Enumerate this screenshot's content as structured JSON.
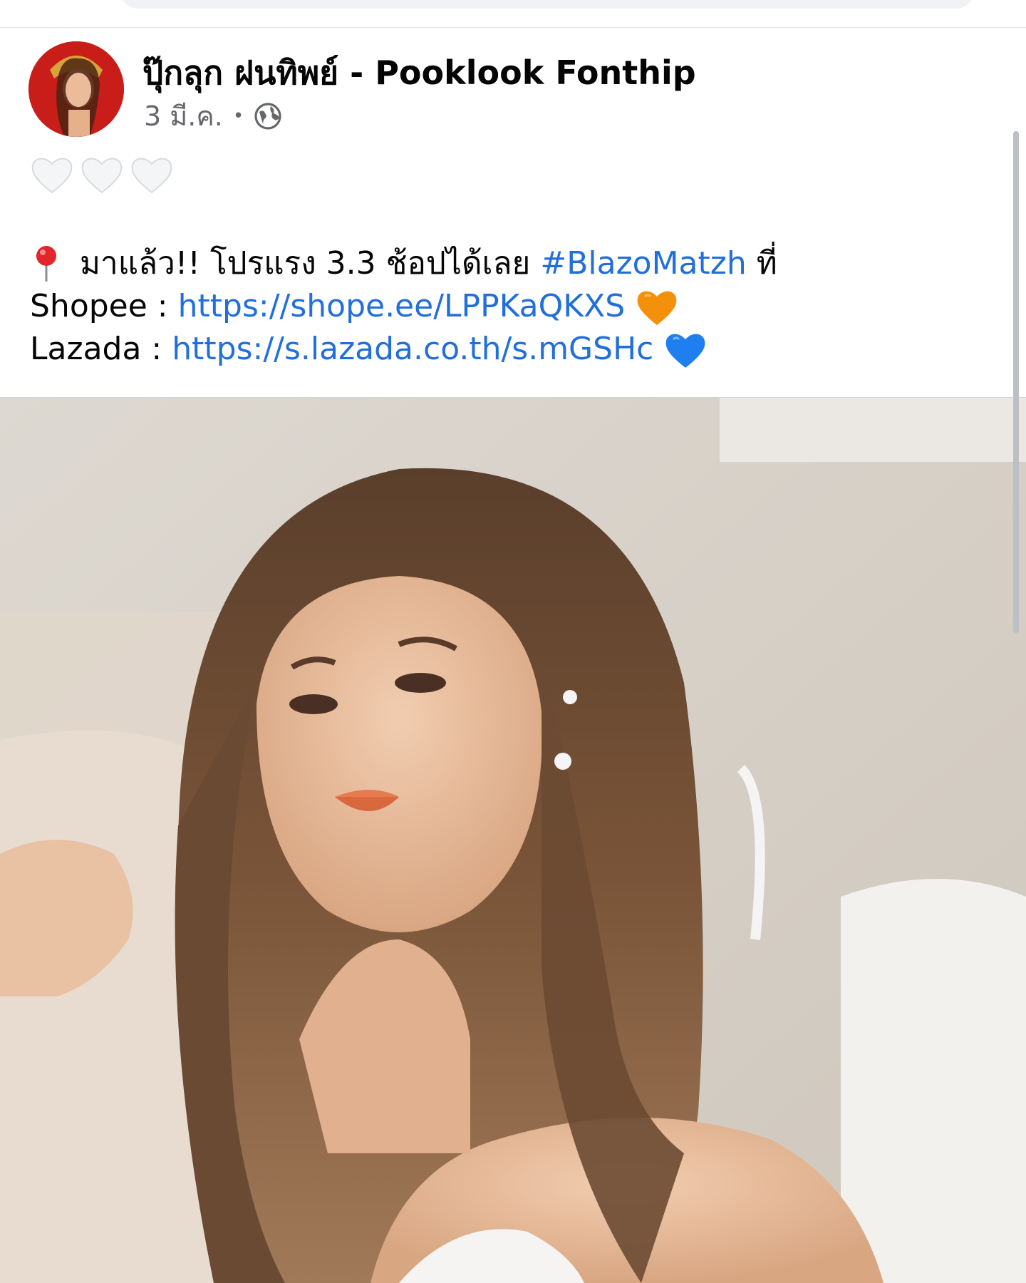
{
  "post": {
    "author": {
      "name": "ปุ๊กลุก ฝนทิพย์ - Pooklook Fonthip"
    },
    "date": "3 มี.ค.",
    "separator": "•",
    "privacy_icon": "globe-icon",
    "hearts_icon": "white-heart-icon",
    "hearts_count": 3,
    "lines": [
      {
        "icon": "pin-icon",
        "text": "มาแล้ว!! โปรแรง 3.3 ช้อปได้เลย",
        "hashtag": "#BlazoMatzh",
        "suffix": "ที่"
      },
      {
        "label": "Shopee :",
        "url": "https://shope.ee/LPPKaQKXS",
        "icon": "orange-heart-icon"
      },
      {
        "label": "Lazada :",
        "url": "https://s.lazada.co.th/s.mGSHc",
        "icon": "blue-heart-icon"
      }
    ],
    "photo_icon": "post-photo"
  },
  "colors": {
    "link": "#216fdb",
    "text": "#050505",
    "meta": "#65676b",
    "orange_heart": "#f4900c",
    "blue_heart": "#1f7ff0"
  }
}
